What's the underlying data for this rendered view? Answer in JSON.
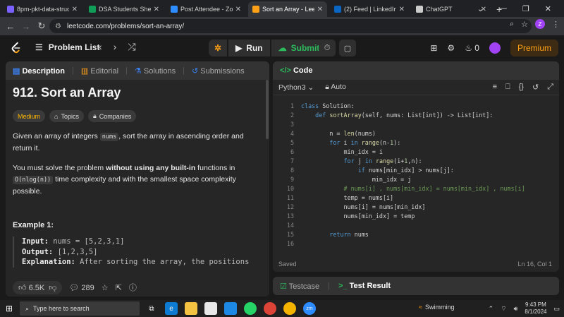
{
  "browser": {
    "tabs": [
      {
        "title": "8pm-pkt-data-struc",
        "color": "#7b61ff",
        "active": false
      },
      {
        "title": "DSA Students Sheet.x",
        "color": "#0f9d58",
        "active": false
      },
      {
        "title": "Post Attendee - Zoom",
        "color": "#2d8cff",
        "active": false
      },
      {
        "title": "Sort an Array - LeetC",
        "color": "#ffa116",
        "active": true
      },
      {
        "title": "(2) Feed | LinkedIn",
        "color": "#0a66c2",
        "active": false
      },
      {
        "title": "ChatGPT",
        "color": "#cccccc",
        "active": false
      }
    ],
    "url": "leetcode.com/problems/sort-an-array/",
    "profile_initial": "Z"
  },
  "leetcode_nav": {
    "problem_list": "Problem List",
    "run": "Run",
    "submit": "Submit",
    "streak": "0",
    "premium": "Premium"
  },
  "left_panel": {
    "tabs": [
      "Description",
      "Editorial",
      "Solutions",
      "Submissions"
    ],
    "title": "912. Sort an Array",
    "difficulty": "Medium",
    "topics": "Topics",
    "companies": "Companies",
    "p1_a": "Given an array of integers ",
    "p1_code": "nums",
    "p1_b": ", sort the array in ascending order and return it.",
    "p2_a": "You must solve the problem ",
    "p2_bold": "without using any built-in",
    "p2_b": " functions in ",
    "p2_code": "O(nlog(n))",
    "p2_c": " time complexity and with the smallest space complexity possible.",
    "example_head": "Example 1:",
    "input_label": "Input:",
    "input_val": " nums = [5,2,3,1]",
    "output_label": "Output:",
    "output_val": " [1,2,3,5]",
    "expl_label": "Explanation:",
    "expl_val": " After sorting the array, the positions",
    "likes": "6.5K",
    "comments": "289"
  },
  "code_panel": {
    "title": "Code",
    "language": "Python3",
    "mode": "Auto",
    "status": "Saved",
    "cursor": "Ln 16, Col 1",
    "lines": [
      "class Solution:",
      "    def sortArray(self, nums: List[int]) -> List[int]:",
      "",
      "        n = len(nums)",
      "        for i in range(n-1):",
      "            min_idx = i",
      "            for j in range(i+1,n):",
      "                if nums[min_idx] > nums[j]:",
      "                    min_idx = j",
      "            # nums[i] , nums[min_idx] = nums[min_idx] , nums[i]",
      "            temp = nums[i]",
      "            nums[i] = nums[min_idx]",
      "            nums[min_idx] = temp",
      "",
      "        return nums",
      ""
    ]
  },
  "bottom_panel": {
    "testcase": "Testcase",
    "result": "Test Result"
  },
  "taskbar": {
    "search": "Type here to search",
    "weather": "Swimming",
    "time": "9:43 PM",
    "date": "8/1/2024"
  }
}
